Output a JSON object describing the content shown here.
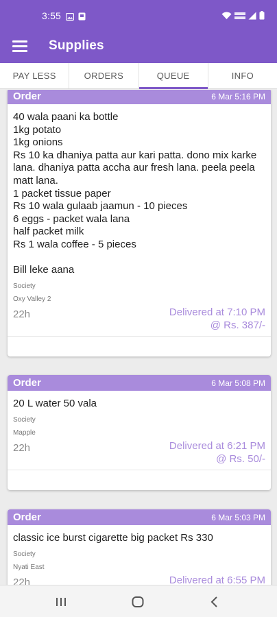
{
  "status_bar": {
    "time": "3:55",
    "left_icons": [
      "image-icon",
      "notification-box-icon"
    ],
    "right_icons": [
      "wifi-icon",
      "volte-icon",
      "signal-icon",
      "battery-icon"
    ]
  },
  "app_bar": {
    "menu_icon": "hamburger-menu-icon",
    "title": "Supplies",
    "color": "#7e58c8"
  },
  "tabs": [
    {
      "label": "PAY LESS",
      "active": false
    },
    {
      "label": "ORDERS",
      "active": false
    },
    {
      "label": "QUEUE",
      "active": true
    },
    {
      "label": "INFO",
      "active": false
    }
  ],
  "orders": [
    {
      "type": "Order",
      "date": "6 Mar 5:16 PM",
      "text": "40 wala paani ka bottle\n1kg potato\n1kg onions\nRs 10 ka dhaniya patta aur kari patta. dono mix karke lana. dhaniya patta accha aur fresh lana. peela peela matt lana.\n1 packet tissue paper\nRs 10 wala gulaab jaamun - 10 pieces\n6 eggs - packet wala lana\nhalf packet milk\nRs 1 wala coffee - 5 pieces\n\nBill leke aana",
      "society_label": "Society",
      "society": "Oxy Valley 2",
      "age": "22h",
      "delivered": "Delivered at 7:10 PM",
      "amount": "@ Rs. 387/-"
    },
    {
      "type": "Order",
      "date": "6 Mar 5:08 PM",
      "text": "20 L water 50 vala",
      "society_label": "Society",
      "society": "Mapple",
      "age": "22h",
      "delivered": "Delivered at 6:21 PM",
      "amount": "@ Rs. 50/-"
    },
    {
      "type": "Order",
      "date": "6 Mar 5:03 PM",
      "text": "classic ice burst cigarette big packet Rs 330",
      "society_label": "Society",
      "society": "Nyati East",
      "age": "22h",
      "delivered": "Delivered at 6:55 PM",
      "amount": ""
    }
  ],
  "nav_bar": {
    "buttons": [
      "recent-apps-icon",
      "home-icon",
      "back-icon"
    ]
  },
  "colors": {
    "accent": "#7e58c8",
    "card_header": "#a98bdc",
    "delivered_text": "#a98bdc"
  }
}
